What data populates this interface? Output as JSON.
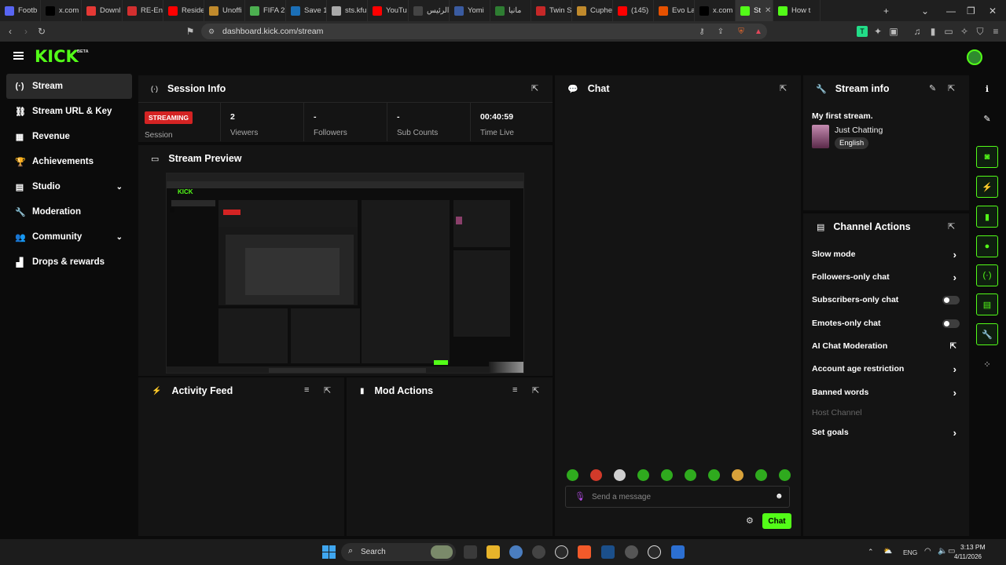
{
  "browser": {
    "tabs": [
      {
        "label": "Footb",
        "color": "#5865f2"
      },
      {
        "label": "x.com",
        "color": "#000000"
      },
      {
        "label": "Downl",
        "color": "#e53935"
      },
      {
        "label": "RE-En",
        "color": "#d32f2f"
      },
      {
        "label": "Reside",
        "color": "#ff0000"
      },
      {
        "label": "Unoffi",
        "color": "#c08a2c"
      },
      {
        "label": "FIFA 2",
        "color": "#4caf50"
      },
      {
        "label": "Save 1",
        "color": "#1b6fb7"
      },
      {
        "label": "sts.kfu",
        "color": "#aaaaaa"
      },
      {
        "label": "YouTu",
        "color": "#ff0000"
      },
      {
        "label": "الرئيس",
        "color": "#444444"
      },
      {
        "label": "Yomi",
        "color": "#3a5ba0"
      },
      {
        "label": "مانيا",
        "color": "#2e7d32"
      },
      {
        "label": "Twin S",
        "color": "#c62828"
      },
      {
        "label": "Cuphe",
        "color": "#c08a2c"
      },
      {
        "label": "(145)",
        "color": "#ff0000"
      },
      {
        "label": "Evo La",
        "color": "#e65100"
      },
      {
        "label": "x.com",
        "color": "#000000"
      },
      {
        "label": "St",
        "color": "#53fc18",
        "active": true
      },
      {
        "label": "How t",
        "color": "#53fc18"
      }
    ],
    "url": "dashboard.kick.com/stream"
  },
  "brand": {
    "logo": "KICK",
    "beta": "BETA",
    "accent": "#53fc18"
  },
  "sidebar": {
    "items": [
      {
        "label": "Stream",
        "icon": "broadcast-icon",
        "glyph": "(·)",
        "active": true
      },
      {
        "label": "Stream URL & Key",
        "icon": "link-icon",
        "glyph": "⛓"
      },
      {
        "label": "Revenue",
        "icon": "chart-icon",
        "glyph": "▦"
      },
      {
        "label": "Achievements",
        "icon": "trophy-icon",
        "glyph": "🏆"
      },
      {
        "label": "Studio",
        "icon": "grid-icon",
        "glyph": "▤",
        "expandable": true
      },
      {
        "label": "Moderation",
        "icon": "wrench-icon",
        "glyph": "🔧"
      },
      {
        "label": "Community",
        "icon": "users-icon",
        "glyph": "👥",
        "expandable": true
      },
      {
        "label": "Drops & rewards",
        "icon": "gift-icon",
        "glyph": "▟"
      }
    ]
  },
  "session": {
    "title": "Session Info",
    "badge": "STREAMING",
    "badge_label": "Session",
    "stats": [
      {
        "value": "2",
        "label": "Viewers"
      },
      {
        "value": "-",
        "label": "Followers"
      },
      {
        "value": "-",
        "label": "Sub Counts"
      },
      {
        "value": "00:40:59",
        "label": "Time Live"
      }
    ]
  },
  "preview": {
    "title": "Stream Preview"
  },
  "activity": {
    "title": "Activity Feed"
  },
  "mod": {
    "title": "Mod Actions"
  },
  "chat": {
    "title": "Chat",
    "placeholder": "Send a message",
    "send_label": "Chat"
  },
  "stream_info": {
    "title": "Stream info",
    "stream_title": "My first stream.",
    "category": "Just Chatting",
    "language": "English"
  },
  "channel_actions": {
    "title": "Channel Actions",
    "items": [
      {
        "label": "Slow mode",
        "control": "arrow"
      },
      {
        "label": "Followers-only chat",
        "control": "arrow"
      },
      {
        "label": "Subscribers-only chat",
        "control": "toggle"
      },
      {
        "label": "Emotes-only chat",
        "control": "toggle"
      },
      {
        "label": "AI Chat Moderation",
        "control": "external"
      },
      {
        "label": "Account age restriction",
        "control": "arrow"
      },
      {
        "label": "Banned words",
        "control": "arrow"
      },
      {
        "label": "Host Channel",
        "control": "none",
        "disabled": true
      },
      {
        "label": "Set goals",
        "control": "arrow"
      }
    ]
  },
  "taskbar": {
    "search_label": "Search",
    "lang": "ENG",
    "time": "3:13 PM",
    "date": "4/11/2026"
  }
}
